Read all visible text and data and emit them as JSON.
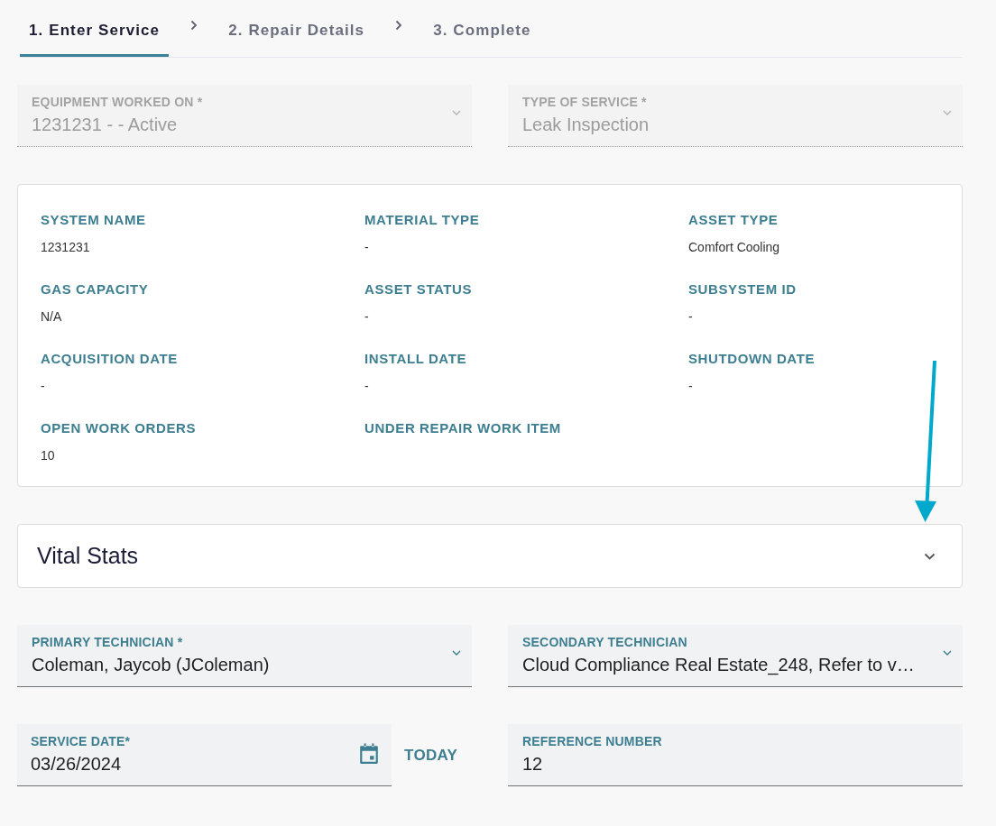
{
  "steps": [
    {
      "label": "1. Enter Service",
      "selected": true
    },
    {
      "label": "2. Repair Details",
      "selected": false
    },
    {
      "label": "3. Complete",
      "selected": false
    }
  ],
  "equipment_fields": [
    {
      "kind": "select",
      "label": "EQUIPMENT WORKED ON *",
      "value": "1231231 - - Active",
      "disabled": true
    },
    {
      "kind": "select",
      "label": "TYPE OF SERVICE *",
      "value": "Leak Inspection",
      "disabled": true
    }
  ],
  "details": [
    {
      "label": "SYSTEM NAME",
      "value": "1231231"
    },
    {
      "label": "MATERIAL TYPE",
      "value": "-"
    },
    {
      "label": "ASSET TYPE",
      "value": "Comfort Cooling"
    },
    {
      "label": "GAS CAPACITY",
      "value": "N/A"
    },
    {
      "label": "ASSET STATUS",
      "value": "-"
    },
    {
      "label": "SUBSYSTEM ID",
      "value": "-"
    },
    {
      "label": "ACQUISITION DATE",
      "value": "-"
    },
    {
      "label": "INSTALL DATE",
      "value": "-"
    },
    {
      "label": "SHUTDOWN DATE",
      "value": "-"
    },
    {
      "label": "OPEN WORK ORDERS",
      "value": "10"
    },
    {
      "label": "UNDER REPAIR WORK ITEM"
    }
  ],
  "annotation": {
    "kind": "arrow"
  },
  "vital_stats": {
    "title": "Vital Stats",
    "expanded": false
  },
  "service_fields": [
    {
      "kind": "select",
      "label": "PRIMARY TECHNICIAN *",
      "value": "Coleman, Jaycob (JColeman)",
      "disabled": false
    },
    {
      "kind": "select",
      "label": "SECONDARY TECHNICIAN",
      "value": "Cloud Compliance Real Estate_248, Refer to v…",
      "disabled": false
    },
    {
      "kind": "date",
      "label": "SERVICE DATE*",
      "value": "03/26/2024",
      "action": "TODAY",
      "disabled": false
    },
    {
      "kind": "text",
      "label": "REFERENCE NUMBER",
      "value": "12",
      "disabled": false
    }
  ]
}
